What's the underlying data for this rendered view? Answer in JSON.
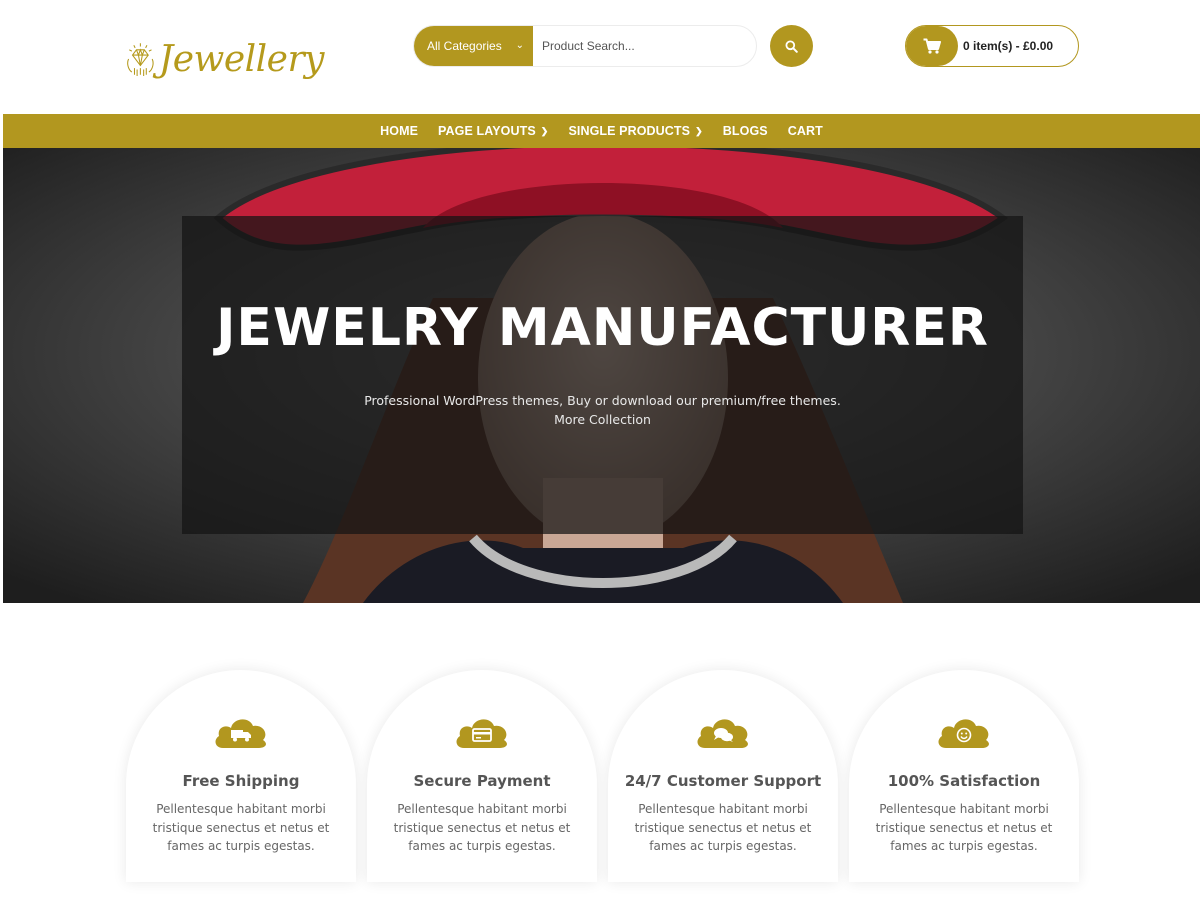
{
  "brand": {
    "name": "Jewellery",
    "accent": "#b2971f"
  },
  "search": {
    "category": "All Categories",
    "placeholder": "Product Search...",
    "button_icon": "search-icon"
  },
  "cart": {
    "label": "0 item(s) - £0.00",
    "icon": "shopping-cart-icon"
  },
  "nav": {
    "items": [
      {
        "label": "HOME",
        "dropdown": false
      },
      {
        "label": "PAGE LAYOUTS",
        "dropdown": true
      },
      {
        "label": "SINGLE PRODUCTS",
        "dropdown": true
      },
      {
        "label": "BLOGS",
        "dropdown": false
      },
      {
        "label": "CART",
        "dropdown": false
      }
    ]
  },
  "hero": {
    "title": "JEWELRY MANUFACTURER",
    "subtitle": "Professional WordPress themes, Buy or download our premium/free themes.",
    "link": "More Collection"
  },
  "features": [
    {
      "title": "Free Shipping",
      "text": "Pellentesque habitant morbi tristique senectus et netus et fames ac turpis egestas.",
      "icon": "truck-icon"
    },
    {
      "title": "Secure Payment",
      "text": "Pellentesque habitant morbi tristique senectus et netus et fames ac turpis egestas.",
      "icon": "credit-card-icon"
    },
    {
      "title": "24/7 Customer Support",
      "text": "Pellentesque habitant morbi tristique senectus et netus et fames ac turpis egestas.",
      "icon": "chat-icon"
    },
    {
      "title": "100% Satisfaction",
      "text": "Pellentesque habitant morbi tristique senectus et netus et fames ac turpis egestas.",
      "icon": "smile-icon"
    }
  ]
}
